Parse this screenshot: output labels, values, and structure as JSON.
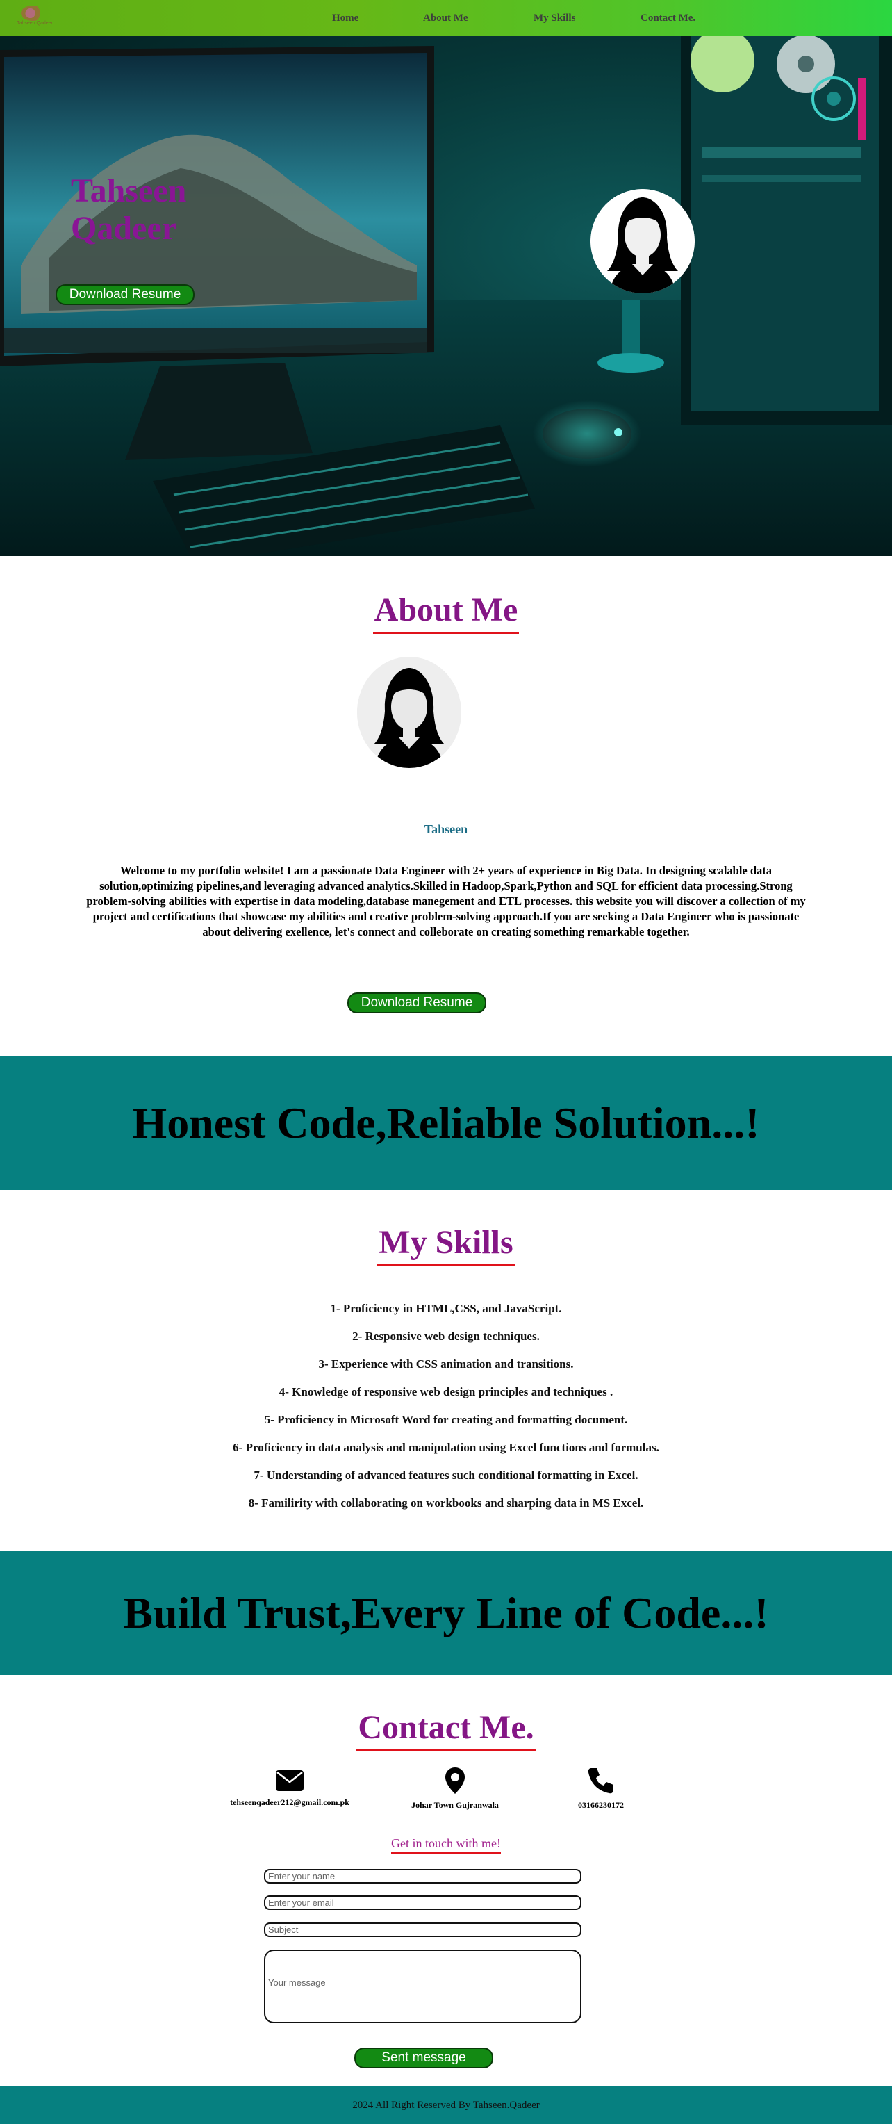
{
  "nav": {
    "logo_text": "Tahseen Qadeer",
    "items": [
      {
        "label": "Home"
      },
      {
        "label": "About Me"
      },
      {
        "label": "My Skills"
      },
      {
        "label": "Contact Me."
      }
    ]
  },
  "hero": {
    "name_line1": "Tahseen",
    "name_line2": "Qadeer",
    "download_label": "Download Resume"
  },
  "about": {
    "title": "About Me",
    "name": "Tahseen",
    "text": "Welcome to my portfolio website! I am a passionate Data Engineer with 2+ years of experience in Big Data. In designing scalable data solution,optimizing pipelines,and leveraging advanced analytics.Skilled in Hadoop,Spark,Python and SQL for efficient data processing.Strong problem-solving abilities with expertise in data modeling,database manegement and ETL processes. this website you will discover a collection of my project and certifications that showcase my abilities and creative problem-solving approach.If you are seeking a Data Engineer who is passionate about delivering exellence, let's connect and colleborate on creating something remarkable together.",
    "download_label": "Download Resume"
  },
  "banner1": "Honest Code,Reliable Solution...!",
  "skills": {
    "title": "My Skills",
    "items": [
      "1- Proficiency in HTML,CSS, and JavaScript.",
      "2- Responsive web design techniques.",
      "3- Experience with CSS animation and transitions.",
      "4- Knowledge of responsive web design principles and techniques .",
      "5- Proficiency in Microsoft Word for creating and formatting document.",
      "6- Proficiency in data analysis and manipulation using Excel functions and formulas.",
      "7- Understanding of advanced features such conditional formatting in Excel.",
      "8- Familirity with collaborating on workbooks and sharping data in MS Excel."
    ]
  },
  "banner2": "Build Trust,Every Line of Code...!",
  "contact": {
    "title": "Contact Me.",
    "email": "tehseenqadeer212@gmail.com.pk",
    "address": "Johar Town Gujranwala",
    "phone": "03166230172",
    "get_in_touch": "Get in touch with me!",
    "form": {
      "name_placeholder": "Enter your name",
      "email_placeholder": "Enter your email",
      "subject_placeholder": "Subject",
      "message_placeholder": "Your message",
      "submit_label": "Sent message"
    }
  },
  "footer": "2024 All Right Reserved By Tahseen.Qadeer",
  "colors": {
    "accent_purple": "#841685",
    "teal": "#068080",
    "button_green": "#138a13",
    "underline_red": "#e0121b"
  }
}
